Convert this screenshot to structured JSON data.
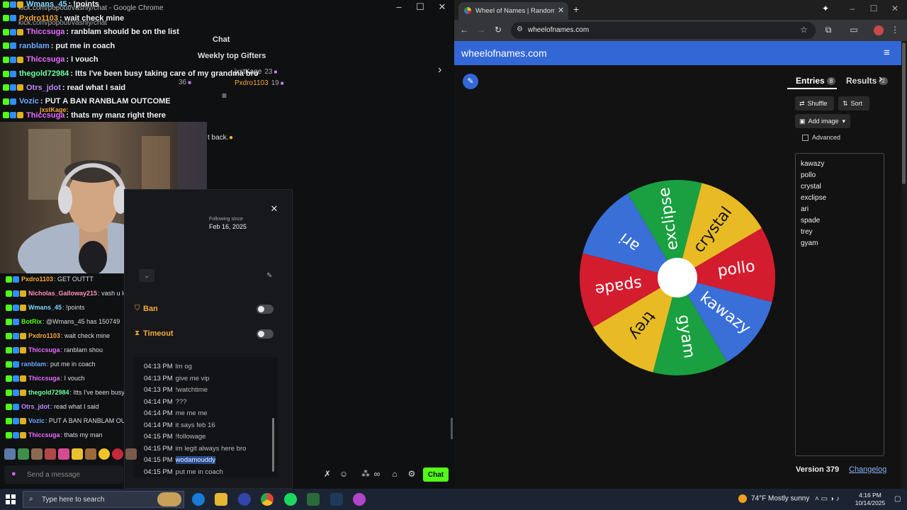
{
  "chat_window": {
    "title": "kick.com/popout/vashly/chat - Google Chrome",
    "url": "kick.com/popout/vashly/chat",
    "chat_heading": "Chat",
    "gifters_title": "Weekly top Gifters",
    "gifters": [
      {
        "name": "jxstKage",
        "count": "23"
      },
      {
        "name": "Pxdro1103",
        "count": "19"
      },
      {
        "name": "",
        "count": "36"
      }
    ],
    "top_messages": [
      {
        "user": "Wmans_45",
        "msg": ": !points",
        "color": "#7ed8ff"
      },
      {
        "user": "Pxdro1103",
        "msg": ": wait check mine",
        "color": "#f5a83a"
      },
      {
        "user": "Thiccsuga",
        "msg": ": ranblam should be on the list",
        "color": "#e86cff"
      },
      {
        "user": "ranblam",
        "msg": ": put me in coach",
        "color": "#6aa8ff"
      },
      {
        "user": "Thiccsuga",
        "msg": ": I vouch",
        "color": "#e86cff"
      },
      {
        "user": "thegold72984",
        "msg": ": Itts I've been busy taking care of my grandma bro",
        "color": "#6bff9e"
      },
      {
        "user": "Otrs_jdot",
        "msg": ": read what I said",
        "color": "#c087ff"
      },
      {
        "user": "Vozic",
        "msg": ": PUT A BAN RANBLAM OUTCOME",
        "color": "#6aa8ff"
      },
      {
        "user": "Thiccsuga",
        "msg": ": thats my manz right there",
        "color": "#e86cff"
      }
    ],
    "partial_line": "jxstKage:",
    "partial_message": "t back.",
    "bottom_messages": [
      {
        "user": "Pxdro1103",
        "msg": ": GET OUTTT",
        "color": "#f5a83a"
      },
      {
        "user": "Nicholas_Galloway215",
        "msg": ": vash u lookin",
        "color": "#ff8fb8"
      },
      {
        "user": "Wmans_45",
        "msg": ": !points",
        "color": "#7ed8ff"
      },
      {
        "user": "BotRix",
        "msg": ": @Wmans_45 has 150749",
        "color": "#53fc18"
      },
      {
        "user": "Pxdro1103",
        "msg": ": wait check mine",
        "color": "#f5a83a"
      },
      {
        "user": "Thiccsuga",
        "msg": ": ranblam shou",
        "color": "#e86cff"
      },
      {
        "user": "ranblam",
        "msg": ": put me in coach",
        "color": "#6aa8ff"
      },
      {
        "user": "Thiccsuga",
        "msg": ": I vouch",
        "color": "#e86cff"
      },
      {
        "user": "thegold72984",
        "msg": ": Itts I've been busy ta",
        "color": "#6bff9e"
      },
      {
        "user": "Otrs_jdot",
        "msg": ": read what I said",
        "color": "#c087ff"
      },
      {
        "user": "Vozic",
        "msg": ": PUT A BAN RANBLAM OU",
        "color": "#6aa8ff"
      },
      {
        "user": "Thiccsuga",
        "msg": ": thats my man",
        "color": "#e86cff"
      }
    ],
    "usercard": {
      "following_label": "Following since",
      "following_date": "Feb 16, 2025",
      "ban_label": "Ban",
      "ban_on": false,
      "timeout_label": "Timeout",
      "timeout_on": false,
      "history": [
        {
          "time": "04:13 PM",
          "text": "lm og"
        },
        {
          "time": "04:13 PM",
          "text": "give me vip"
        },
        {
          "time": "04:13 PM",
          "text": "!watchtime"
        },
        {
          "time": "04:14 PM",
          "text": "???"
        },
        {
          "time": "04:14 PM",
          "text": "me me me"
        },
        {
          "time": "04:14 PM",
          "text": "it says feb 16"
        },
        {
          "time": "04:15 PM",
          "text": "!followage"
        },
        {
          "time": "04:15 PM",
          "text": "im legit always here bro"
        },
        {
          "time": "04:15 PM",
          "text": "wodamouddy",
          "selected": true
        },
        {
          "time": "04:15 PM",
          "text": "put me in coach"
        }
      ]
    },
    "input_placeholder": "Send a message",
    "send_label": "Chat"
  },
  "browser": {
    "tab_title": "Wheel of Names | Random name picker",
    "url": "wheelofnames.com",
    "site_title": "wheelofnames.com",
    "tabs": {
      "entries": "Entries",
      "entries_count": "8",
      "results": "Results",
      "results_count": "2"
    },
    "shuffle_label": "Shuffle",
    "sort_label": "Sort",
    "add_image_label": "Add image",
    "advanced_label": "Advanced",
    "entries": [
      "kawazy",
      "pollo",
      "crystal",
      "exclipse",
      "ari",
      "spade",
      "trey",
      "gyam"
    ],
    "version": "Version 379",
    "changelog": "Changelog",
    "wheel_colors": {
      "green": "#1aa040",
      "yellow": "#e8bb25",
      "red": "#d41c2f",
      "blue": "#3a6fd8"
    }
  },
  "taskbar": {
    "search_placeholder": "Type here to search",
    "weather": "74°F  Mostly sunny",
    "time": "4:16 PM",
    "date": "10/14/2025"
  }
}
